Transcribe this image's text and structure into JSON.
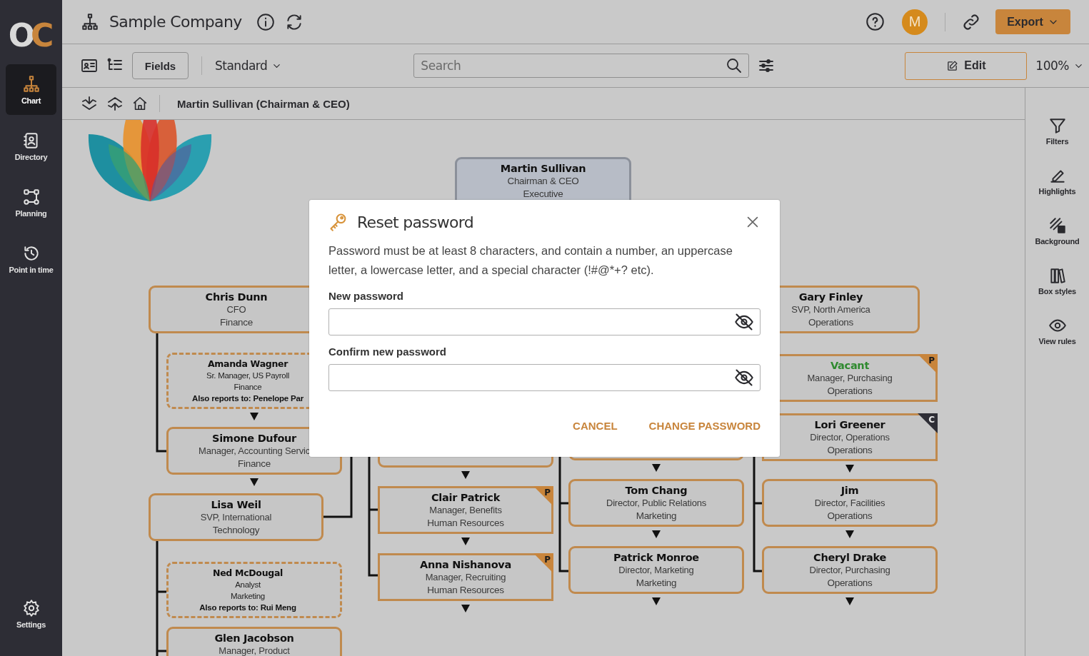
{
  "logo": {
    "text": "OC"
  },
  "sidebar": {
    "items": [
      {
        "label": "Chart",
        "selected": true
      },
      {
        "label": "Directory",
        "selected": false
      },
      {
        "label": "Planning",
        "selected": false
      },
      {
        "label": "Point in time",
        "selected": false
      }
    ],
    "footer": {
      "label": "Settings"
    }
  },
  "header": {
    "title": "Sample Company",
    "avatar": "M",
    "export_button": "Export"
  },
  "toolbar": {
    "fields_button": "Fields",
    "view": "Standard",
    "search": {
      "placeholder": "Search"
    },
    "edit_button": "Edit",
    "zoom": "100%"
  },
  "breadcrumb": {
    "path": "Martin Sullivan (Chairman & CEO)"
  },
  "right_panel": {
    "items": [
      {
        "label": "Filters"
      },
      {
        "label": "Highlights"
      },
      {
        "label": "Background"
      },
      {
        "label": "Box styles"
      },
      {
        "label": "View rules"
      }
    ]
  },
  "chart": {
    "nodes": [
      {
        "kind": "root",
        "name": "Martin Sullivan",
        "title": "Chairman & CEO",
        "department": "Executive",
        "collapsed": false
      },
      {
        "kind": "solid",
        "name": "Chris  Dunn",
        "title": "CFO",
        "department": "Finance",
        "collapsed": false
      },
      {
        "kind": "dashed",
        "name": "Amanda Wagner",
        "title": "Sr. Manager, US Payroll",
        "department": "Finance",
        "also_reports_to": "Also reports to: Penelope Par",
        "collapsed": true
      },
      {
        "kind": "solid",
        "name": "Simone Dufour",
        "title": "Manager, Accounting Servic",
        "department": "Finance",
        "collapsed": true
      },
      {
        "kind": "solid",
        "name": "Lisa Weil",
        "title": "SVP, International",
        "department": "Technology",
        "collapsed": false
      },
      {
        "kind": "dashed",
        "name": "Ned McDougal",
        "title": "Analyst",
        "department": "Marketing",
        "also_reports_to": "Also reports to: Rui Meng",
        "collapsed": false
      },
      {
        "kind": "solid",
        "name": "Glen Jacobson",
        "title": "Manager, Product",
        "collapsed": false
      },
      {
        "kind": "solid",
        "collapsed": true
      },
      {
        "kind": "solid",
        "name": "Clair Patrick",
        "title": "Manager, Benefits",
        "department": "Human Resources",
        "badge": {
          "label": "P",
          "color": "#c8853c"
        },
        "collapsed": true
      },
      {
        "kind": "solid",
        "name": "Anna Nishanova",
        "title": "Manager, Recruiting",
        "department": "Human Resources",
        "badge": {
          "label": "P",
          "color": "#c8853c"
        },
        "collapsed": true
      },
      {
        "kind": "solid",
        "collapsed": true
      },
      {
        "kind": "solid",
        "name": "Tom Chang",
        "title": "Director, Public Relations",
        "department": "Marketing",
        "collapsed": true
      },
      {
        "kind": "solid",
        "name": "Patrick Monroe",
        "title": "Director, Marketing",
        "department": "Marketing",
        "collapsed": true
      },
      {
        "kind": "solid",
        "name": "Gary Finley",
        "title": "SVP, North America",
        "department": "Operations",
        "collapsed": false
      },
      {
        "kind": "solid",
        "name": "Vacant",
        "vacant": true,
        "title": "Manager, Purchasing",
        "department": "Operations",
        "badge": {
          "label": "P",
          "color": "#c8853c"
        },
        "collapsed": false
      },
      {
        "kind": "solid",
        "name": "Lori Greener",
        "title": "Director, Operations",
        "department": "Operations",
        "badge": {
          "label": "C",
          "color": "#2e2e36"
        },
        "collapsed": true
      },
      {
        "kind": "solid",
        "name": "Jim",
        "title": "Director, Facilities",
        "department": "Operations",
        "collapsed": true
      },
      {
        "kind": "solid",
        "name": "Cheryl Drake",
        "title": "Director, Purchasing",
        "department": "Operations",
        "collapsed": true
      }
    ]
  },
  "dialog": {
    "title": "Reset password",
    "message": "Password must be at least 8 characters, and contain a number, an uppercase letter, a lowercase letter, and a special character (!#@*+? etc).",
    "fields": [
      {
        "label": "New password"
      },
      {
        "label": "Confirm new password"
      }
    ],
    "buttons": [
      "CANCEL",
      "CHANGE PASSWORD"
    ]
  }
}
